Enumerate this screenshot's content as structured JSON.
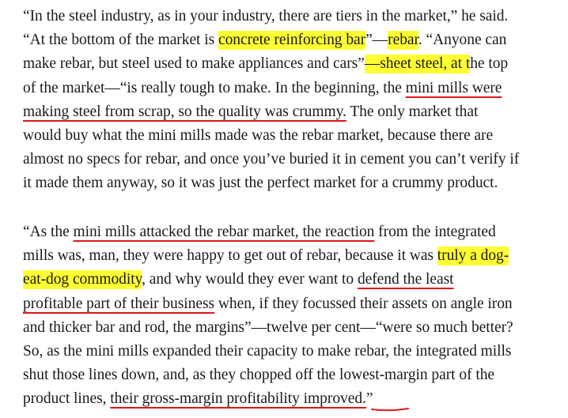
{
  "article": {
    "paragraphs": [
      {
        "lines": [
          [
            {
              "t": "“In the steel industry, as in your industry, there are tiers in the market,” he said."
            }
          ],
          [
            {
              "t": "“At the bottom of the market is "
            },
            {
              "t": "concrete reinforcing bar",
              "m": "hl"
            },
            {
              "t": "”—"
            },
            {
              "t": "rebar",
              "m": "hl"
            },
            {
              "t": ". “Anyone can"
            }
          ],
          [
            {
              "t": "make rebar, but steel used to make appliances and cars”"
            },
            {
              "t": "—sheet steel, at t",
              "m": "hl"
            },
            {
              "t": "he top"
            }
          ],
          [
            {
              "t": "of the market—“is really tough to make. In the beginning, the "
            },
            {
              "t": "mini mills were",
              "m": "ul"
            }
          ],
          [
            {
              "t": "making steel from scrap, so the quality was crummy.",
              "m": "ul"
            },
            {
              "t": " The only market that"
            }
          ],
          [
            {
              "t": "would buy what the mini mills made was the rebar market, because there are"
            }
          ],
          [
            {
              "t": "almost no specs for rebar, and once you’ve buried it in cement you can’t verify if"
            }
          ],
          [
            {
              "t": "it made them anyway, so it was just the perfect market for a crummy product."
            }
          ]
        ]
      },
      {
        "lines": [
          [
            {
              "t": "“As the "
            },
            {
              "t": "mini mills attacked the rebar market, the reaction",
              "m": "ul"
            },
            {
              "t": " from the integrated"
            }
          ],
          [
            {
              "t": "mills was, man, they were happy to get out of rebar, because it was "
            },
            {
              "t": "truly a dog-",
              "m": "hl"
            }
          ],
          [
            {
              "t": "eat-dog commodity",
              "m": "hl"
            },
            {
              "t": ", and why would they ever want to "
            },
            {
              "t": "defend the least",
              "m": "ul"
            }
          ],
          [
            {
              "t": "profitable part of their business",
              "m": "ul"
            },
            {
              "t": " when, if they focussed their assets on angle iron"
            }
          ],
          [
            {
              "t": "and thicker bar and rod, the margins”—twelve per cent—“were so much better?"
            }
          ],
          [
            {
              "t": "So, as the mini mills expanded their capacity to make rebar, the integrated mills"
            }
          ],
          [
            {
              "t": "shut those lines down, and, as they chopped off the lowest-margin part of the"
            }
          ],
          [
            {
              "t": "product lines, "
            },
            {
              "t": "their gross-margin profitability improved.",
              "m": "ul"
            },
            {
              "t": "”"
            }
          ]
        ]
      }
    ]
  },
  "annotations": {
    "highlight_color": "#ffff33",
    "pen_color": "#e01515"
  }
}
